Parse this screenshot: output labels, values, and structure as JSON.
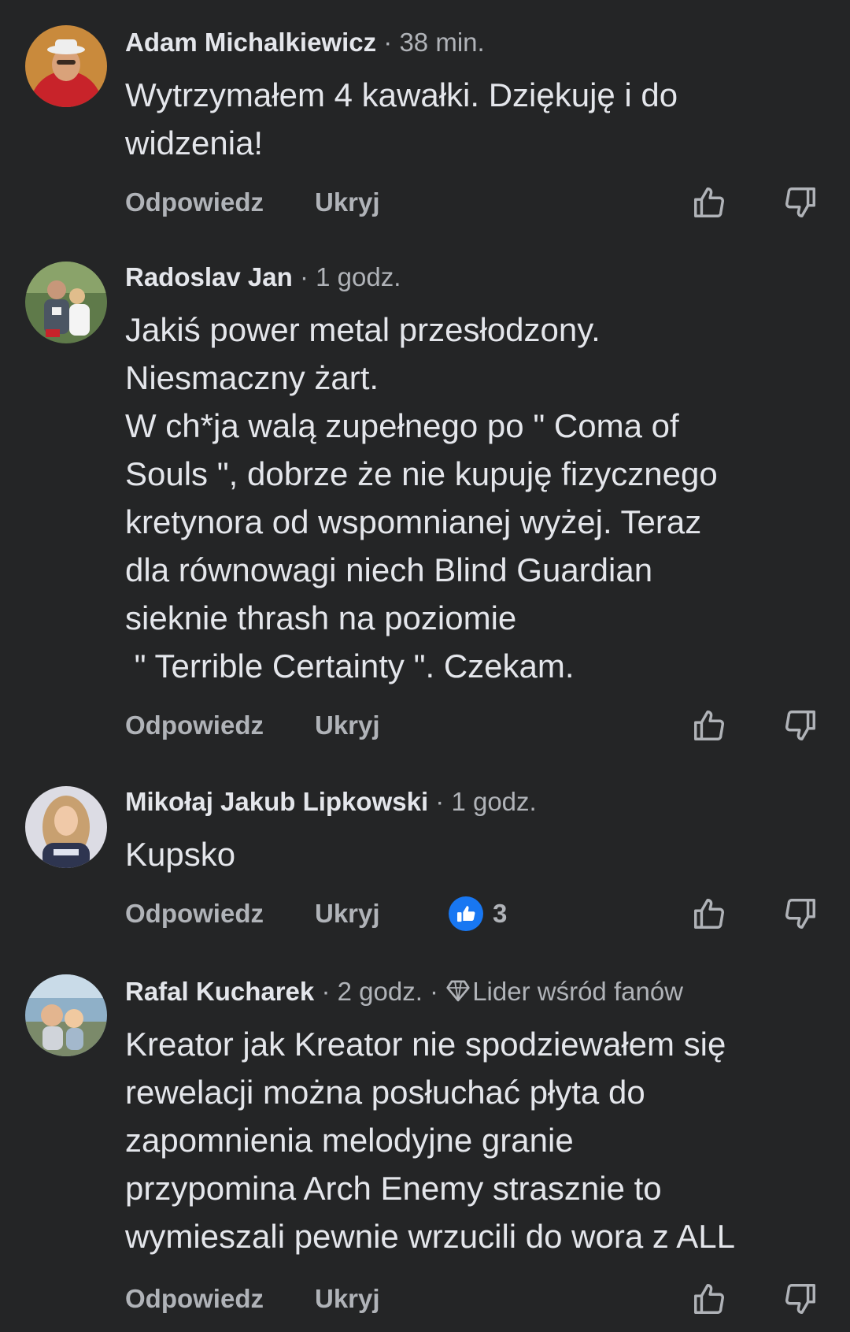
{
  "comments": [
    {
      "author": "Adam Michalkiewicz",
      "separator": "·",
      "time": "38 min.",
      "lines": [
        "Wytrzymałem 4 kawałki. Dziękuję i do",
        "widzenia!"
      ],
      "reply_label": "Odpowiedz",
      "hide_label": "Ukryj"
    },
    {
      "author": "Radoslav Jan",
      "separator": "·",
      "time": "1 godz.",
      "lines": [
        "Jakiś power metal przesłodzony.",
        "Niesmaczny żart.",
        "W ch*ja walą zupełnego po \" Coma of",
        "Souls \", dobrze że nie kupuję fizycznego",
        "kretynora od wspomnianej wyżej. Teraz",
        "dla równowagi niech Blind Guardian",
        "sieknie thrash na poziomie",
        " \" Terrible Certainty \". Czekam."
      ],
      "reply_label": "Odpowiedz",
      "hide_label": "Ukryj"
    },
    {
      "author": "Mikołaj Jakub Lipkowski",
      "separator": "·",
      "time": "1 godz.",
      "lines": [
        "Kupsko"
      ],
      "reply_label": "Odpowiedz",
      "hide_label": "Ukryj",
      "reaction_count": "3"
    },
    {
      "author": "Rafal Kucharek",
      "separator": "·",
      "time": "2 godz.",
      "badge": "Lider wśród fanów",
      "lines": [
        "Kreator jak Kreator nie spodziewałem się",
        "rewelacji można posłuchać płyta do",
        "zapomnienia melodyjne granie",
        "przypomina Arch Enemy strasznie to",
        "wymieszali pewnie wrzucili do wora z ALL"
      ],
      "reply_label": "Odpowiedz",
      "hide_label": "Ukryj"
    }
  ],
  "icons": {
    "like": "thumbs-up-outline-icon",
    "dislike": "thumbs-down-outline-icon",
    "reaction": "like-reaction-icon",
    "badge": "diamond-icon"
  },
  "colors": {
    "background": "#242526",
    "text": "#e4e6eb",
    "secondary": "#b0b3b8",
    "like_blue": "#1877f2"
  }
}
